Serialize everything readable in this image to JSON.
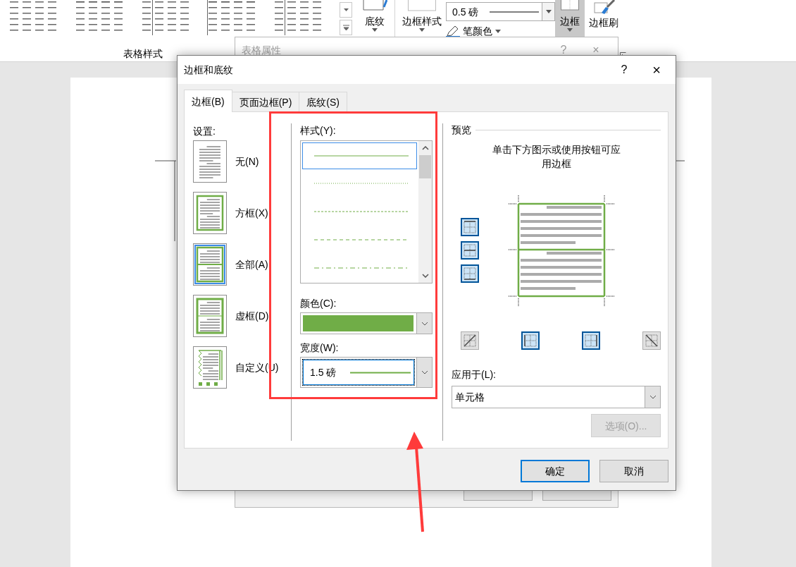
{
  "ribbon": {
    "gallery_label": "表格样式",
    "shading": {
      "label": "底纹"
    },
    "border_styles": {
      "label": "边框样式"
    },
    "pen_weight": {
      "value": "0.5 磅"
    },
    "pen_color": {
      "label": "笔颜色"
    },
    "borders": {
      "label": "边框",
      "selected": true
    },
    "border_painter": {
      "label": "边框刷"
    }
  },
  "back_dialog": {
    "title": "表格属性",
    "help": "?",
    "close": "×"
  },
  "dialog": {
    "title": "边框和底纹",
    "help": "?",
    "close": "×",
    "tabs": [
      {
        "label": "边框(B)",
        "selected": true
      },
      {
        "label": "页面边框(P)",
        "selected": false
      },
      {
        "label": "底纹(S)",
        "selected": false
      }
    ],
    "settings": {
      "label": "设置:",
      "items": [
        {
          "label": "无(N)",
          "kind": "none",
          "selected": false
        },
        {
          "label": "方框(X)",
          "kind": "box",
          "selected": false
        },
        {
          "label": "全部(A)",
          "kind": "all",
          "selected": true
        },
        {
          "label": "虚框(D)",
          "kind": "grid",
          "selected": false
        },
        {
          "label": "自定义(U)",
          "kind": "custom",
          "selected": false
        }
      ]
    },
    "style": {
      "label": "样式(Y):",
      "items": [
        {
          "kind": "solid",
          "selected": true
        },
        {
          "kind": "dotted",
          "selected": false
        },
        {
          "kind": "fine-dashed",
          "selected": false
        },
        {
          "kind": "dashed",
          "selected": false
        },
        {
          "kind": "dash-dot",
          "selected": false
        }
      ]
    },
    "color": {
      "label": "颜色(C):",
      "color": "#70ad47"
    },
    "width": {
      "label": "宽度(W):",
      "value": "1.5 磅"
    },
    "preview": {
      "label": "预览",
      "hint": "单击下方图示或使用按钮可应用边框",
      "side_buttons": [
        {
          "kind": "top",
          "on": true
        },
        {
          "kind": "inside-horizontal",
          "on": true
        },
        {
          "kind": "bottom",
          "on": true
        }
      ],
      "bottom_buttons": [
        {
          "kind": "diagonal-up",
          "on": false
        },
        {
          "kind": "left",
          "on": true
        },
        {
          "kind": "right",
          "on": true
        },
        {
          "kind": "diagonal-down",
          "on": false
        }
      ]
    },
    "apply_to": {
      "label": "应用于(L):",
      "value": "单元格"
    },
    "options_button": {
      "label": "选项(O)...",
      "disabled": true
    },
    "buttons": [
      {
        "label": "确定",
        "default": true
      },
      {
        "label": "取消",
        "default": false
      }
    ]
  }
}
